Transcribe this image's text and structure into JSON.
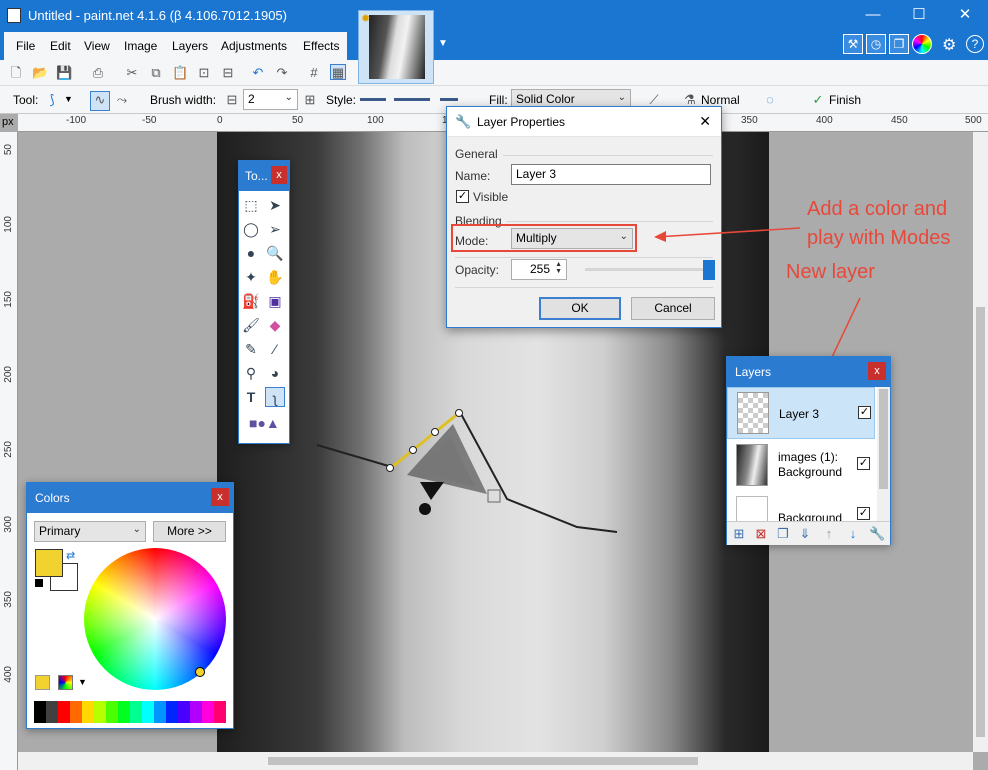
{
  "window": {
    "title": "Untitled - paint.net 4.1.6 (β 4.106.7012.1905)",
    "minimize": "—",
    "maximize": "☐",
    "close": "✕"
  },
  "menu": [
    "File",
    "Edit",
    "View",
    "Image",
    "Layers",
    "Adjustments",
    "Effects"
  ],
  "toolbar": {
    "tool_label": "Tool:",
    "brush_width_label": "Brush width:",
    "brush_width_value": "2",
    "style_label": "Style:",
    "fill_label": "Fill:",
    "fill_value": "Solid Color",
    "blend_value": "Normal",
    "finish_label": "Finish"
  },
  "rulers": {
    "unit": "px",
    "h_ticks": [
      "-100",
      "-50",
      "0",
      "50",
      "100",
      "150",
      "200",
      "250",
      "300",
      "350",
      "400",
      "450",
      "500"
    ],
    "v_ticks": [
      "50",
      "100",
      "150",
      "200",
      "250",
      "300",
      "350",
      "400"
    ]
  },
  "tools_window": {
    "title": "To...",
    "close": "x"
  },
  "layer_properties": {
    "title": "Layer Properties",
    "general_label": "General",
    "name_label": "Name:",
    "name_value": "Layer 3",
    "visible_label": "Visible",
    "visible_checked": true,
    "blending_label": "Blending",
    "mode_label": "Mode:",
    "mode_value": "Multiply",
    "opacity_label": "Opacity:",
    "opacity_value": "255",
    "ok_label": "OK",
    "cancel_label": "Cancel",
    "close": "✕"
  },
  "annotations": {
    "modes_note_line1": "Add a color and",
    "modes_note_line2": "play with Modes",
    "new_layer_note": "New layer",
    "color": "#e8483a"
  },
  "layers_window": {
    "title": "Layers",
    "close": "x",
    "items": [
      {
        "name": "Layer 3",
        "checked": true,
        "selected": true
      },
      {
        "name": "images (1): Background",
        "checked": true,
        "selected": false
      },
      {
        "name": "Background",
        "checked": true,
        "selected": false
      }
    ]
  },
  "colors_window": {
    "title": "Colors",
    "close": "x",
    "primary_select": "Primary",
    "more_button": "More >>",
    "primary_color": "#f2d22e",
    "secondary_color": "#ffffff",
    "palette": [
      "#000000",
      "#404040",
      "#ff0000",
      "#ff6a00",
      "#ffd800",
      "#b6ff00",
      "#4cff00",
      "#00ff21",
      "#00ff90",
      "#00ffff",
      "#0094ff",
      "#0026ff",
      "#4800ff",
      "#b200ff",
      "#ff00dc",
      "#ff006e"
    ]
  },
  "accent_color": "#1b76d2"
}
